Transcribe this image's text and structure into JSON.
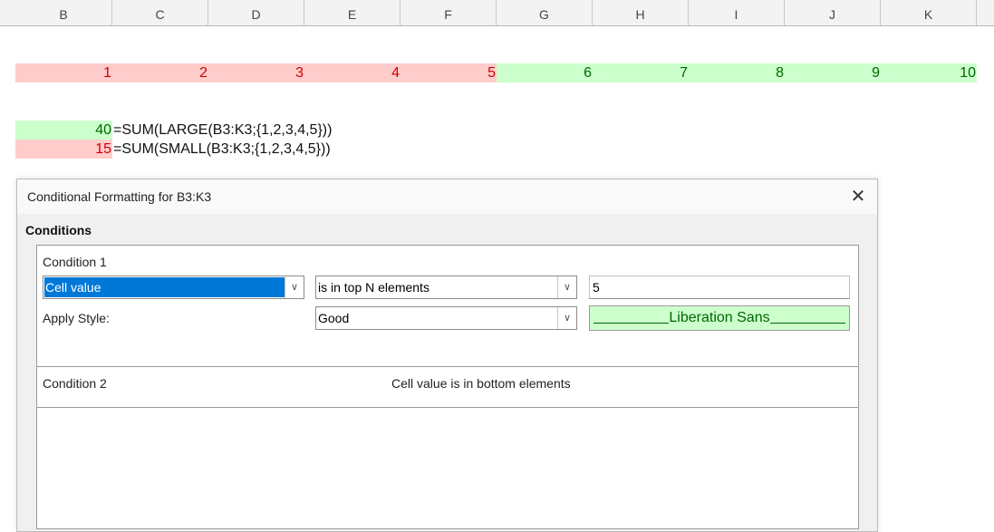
{
  "columns": [
    "B",
    "C",
    "D",
    "E",
    "F",
    "G",
    "H",
    "I",
    "J",
    "K"
  ],
  "row3": {
    "values": [
      "1",
      "2",
      "3",
      "4",
      "5",
      "6",
      "7",
      "8",
      "9",
      "10"
    ],
    "styles": [
      "red",
      "red",
      "red",
      "red",
      "red",
      "green",
      "green",
      "green",
      "green",
      "green"
    ]
  },
  "results": [
    {
      "value": "40",
      "style": "green",
      "formula": "=SUM(LARGE(B3:K3;{1,2,3,4,5}))"
    },
    {
      "value": "15",
      "style": "red",
      "formula": "=SUM(SMALL(B3:K3;{1,2,3,4,5}))"
    }
  ],
  "dialog": {
    "title": "Conditional Formatting for B3:K3",
    "section": "Conditions",
    "condition1": {
      "label": "Condition 1",
      "type": "Cell value",
      "operator": "is in top N elements",
      "value": "5",
      "apply_style_label": "Apply Style:",
      "style": "Good",
      "preview_font": "Liberation Sans"
    },
    "condition2": {
      "label": "Condition 2",
      "summary": "Cell value is in bottom elements"
    }
  },
  "colors": {
    "bad_bg": "#ffcccc",
    "bad_fg": "#cc0000",
    "good_bg": "#ccffcc",
    "good_fg": "#006600",
    "selection": "#0078d7"
  }
}
